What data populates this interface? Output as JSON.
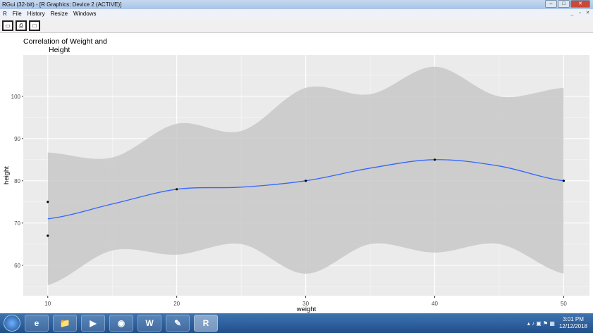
{
  "window": {
    "title": "RGui (32-bit) - [R Graphics: Device 2 (ACTIVE)]"
  },
  "menu": [
    "File",
    "History",
    "Resize",
    "Windows"
  ],
  "toolbar": [
    {
      "icon": "copy-metafile-icon"
    },
    {
      "icon": "print-icon"
    },
    {
      "icon": "window-icon"
    }
  ],
  "chart_data": {
    "type": "scatter",
    "title": "Correlation of Weight and\nHeight",
    "title_lines": [
      "Correlation of Weight and",
      "Height"
    ],
    "xlabel": "weight",
    "ylabel": "height",
    "xlim": [
      8.1,
      52.0
    ],
    "ylim": [
      52.8,
      109.8
    ],
    "xticks": [
      10,
      20,
      30,
      40,
      50
    ],
    "yticks": [
      60,
      70,
      80,
      90,
      100
    ],
    "grid": true,
    "points": [
      {
        "x": 10,
        "y": 75
      },
      {
        "x": 10,
        "y": 67
      },
      {
        "x": 20,
        "y": 78
      },
      {
        "x": 30,
        "y": 80
      },
      {
        "x": 40,
        "y": 85
      },
      {
        "x": 50,
        "y": 80
      }
    ],
    "smooth": {
      "x": [
        10,
        15,
        20,
        25,
        30,
        35,
        40,
        45,
        50
      ],
      "y": [
        71,
        74.5,
        78,
        78.5,
        80,
        83,
        85,
        83.5,
        80
      ],
      "upper": [
        86.7,
        85.5,
        93.5,
        91.8,
        102,
        100.5,
        107,
        100,
        102
      ],
      "lower": [
        55.3,
        63.5,
        62.5,
        65,
        58,
        65,
        63,
        65,
        58
      ]
    },
    "colors": {
      "line": "#3366ff",
      "band": "#c8c8c8",
      "panel": "#ebebeb",
      "point": "#000000"
    }
  },
  "taskbar": {
    "apps": [
      "e",
      "📁",
      "▶",
      "◉",
      "W",
      "✎",
      "R"
    ],
    "time": "3:01 PM",
    "date": "12/12/2018"
  }
}
